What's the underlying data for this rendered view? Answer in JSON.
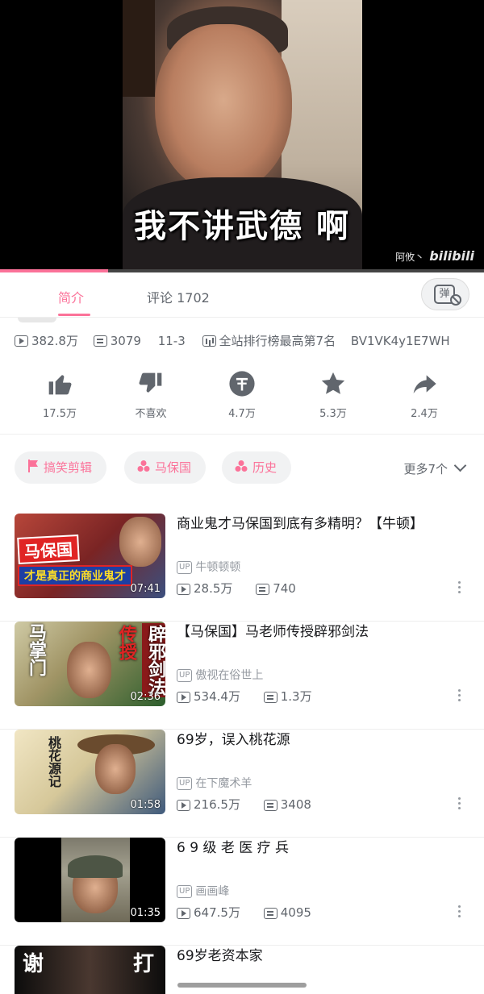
{
  "player": {
    "subtitle": "我不讲武德 啊",
    "watermark_user": "阿攸丶",
    "watermark_brand": "bilibili",
    "progress_fraction": 0.223
  },
  "tabs": [
    {
      "label": "简介",
      "active": true
    },
    {
      "label": "评论 1702",
      "active": false
    }
  ],
  "danmaku_toggle": {
    "label": "弹",
    "state": "off"
  },
  "stats": {
    "views": "382.8万",
    "danmaku": "3079",
    "date": "11-3",
    "rank": "全站排行榜最高第7名",
    "bvid": "BV1VK4y1E7WH"
  },
  "actions": [
    {
      "name": "like",
      "label": "17.5万",
      "icon": "thumb-up-icon"
    },
    {
      "name": "dislike",
      "label": "不喜欢",
      "icon": "thumb-down-icon"
    },
    {
      "name": "coin",
      "label": "4.7万",
      "icon": "coin-icon"
    },
    {
      "name": "favorite",
      "label": "5.3万",
      "icon": "star-icon"
    },
    {
      "name": "share",
      "label": "2.4万",
      "icon": "share-icon"
    }
  ],
  "tags": [
    {
      "label": "搞笑剪辑",
      "icon": "flag-icon"
    },
    {
      "label": "马保国",
      "icon": "topic-icon"
    },
    {
      "label": "历史",
      "icon": "topic-icon"
    }
  ],
  "more_tags": "更多7个",
  "related": [
    {
      "title": "商业鬼才马保国到底有多精明？【牛顿】",
      "up": "牛顿顿顿",
      "views": "28.5万",
      "danmaku": "740",
      "duration": "07:41",
      "thumb_text_1": "马保国",
      "thumb_text_2": "才是真正的商业鬼才"
    },
    {
      "title": "【马保国】马老师传授辟邪剑法",
      "up": "傲视在俗世上",
      "views": "534.4万",
      "danmaku": "1.3万",
      "duration": "02:36",
      "thumb_text_1": "马掌门",
      "thumb_text_2": "传授",
      "thumb_text_3": "辟邪剑法"
    },
    {
      "title": "69岁，误入桃花源",
      "up": "在下魔术羊",
      "views": "216.5万",
      "danmaku": "3408",
      "duration": "01:58",
      "thumb_text_1": "桃花源记"
    },
    {
      "title": "6 9 级 老 医 疗 兵",
      "up": "画画峰",
      "views": "647.5万",
      "danmaku": "4095",
      "duration": "01:35"
    },
    {
      "title": "69岁老资本家",
      "thumb_text_1": "谢",
      "thumb_text_2": "打"
    }
  ],
  "labels": {
    "up_badge": "UP"
  },
  "colors": {
    "accent": "#fb7299",
    "text_secondary": "#61666d"
  }
}
